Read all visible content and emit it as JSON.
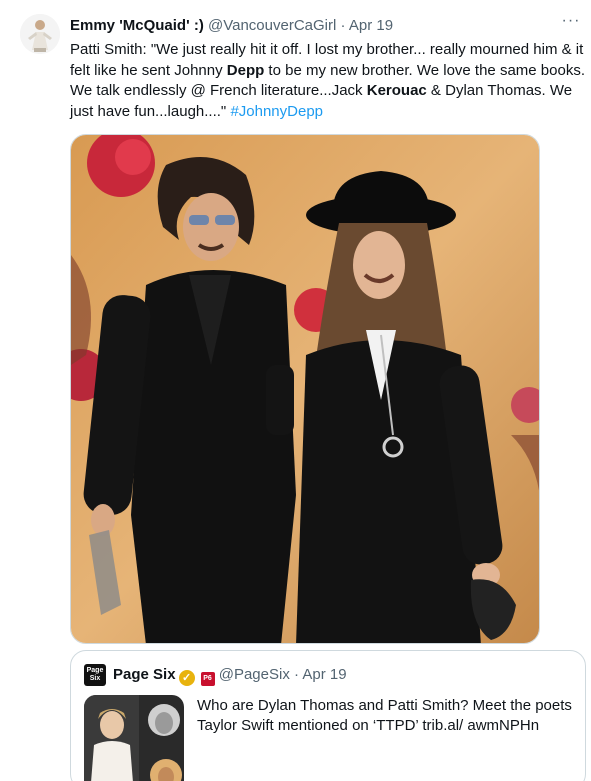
{
  "tweet": {
    "author_name": "Emmy 'McQuaid' :)",
    "author_handle": "@VancouverCaGirl",
    "separator": "·",
    "date": "Apr 19",
    "more_label": "···",
    "text_parts": {
      "p1": "Patti Smith: \"We just really hit it off. I lost my brother... really mourned him & it felt like he sent Johnny ",
      "b1": "Depp",
      "p2": " to be my new brother. We love the same books. We talk endlessly @ French literature...Jack ",
      "b2": "Kerouac",
      "p3": " & Dylan Thomas. We just have fun...laugh....\" ",
      "hashtag": "#JohnnyDepp"
    }
  },
  "quote": {
    "logo_text_top": "Page",
    "logo_text_bottom": "Six",
    "author_name": "Page Six",
    "verified_mark": "✓",
    "affiliate_mark": "P6",
    "author_handle": "@PageSix",
    "separator": "·",
    "date": "Apr 19",
    "text": "Who are Dylan Thomas and Patti Smith? Meet the poets Taylor Swift mentioned on ‘TTPD’ trib.al/ awmNPHn"
  },
  "icons": {
    "more": "more-horizontal-icon",
    "verified": "verified-badge-icon",
    "affiliate": "affiliate-badge-icon"
  },
  "colors": {
    "text": "#0f1419",
    "secondary": "#536471",
    "link": "#1d9bf0",
    "border": "#cfd9de",
    "verified_gold": "#e8b30e"
  }
}
